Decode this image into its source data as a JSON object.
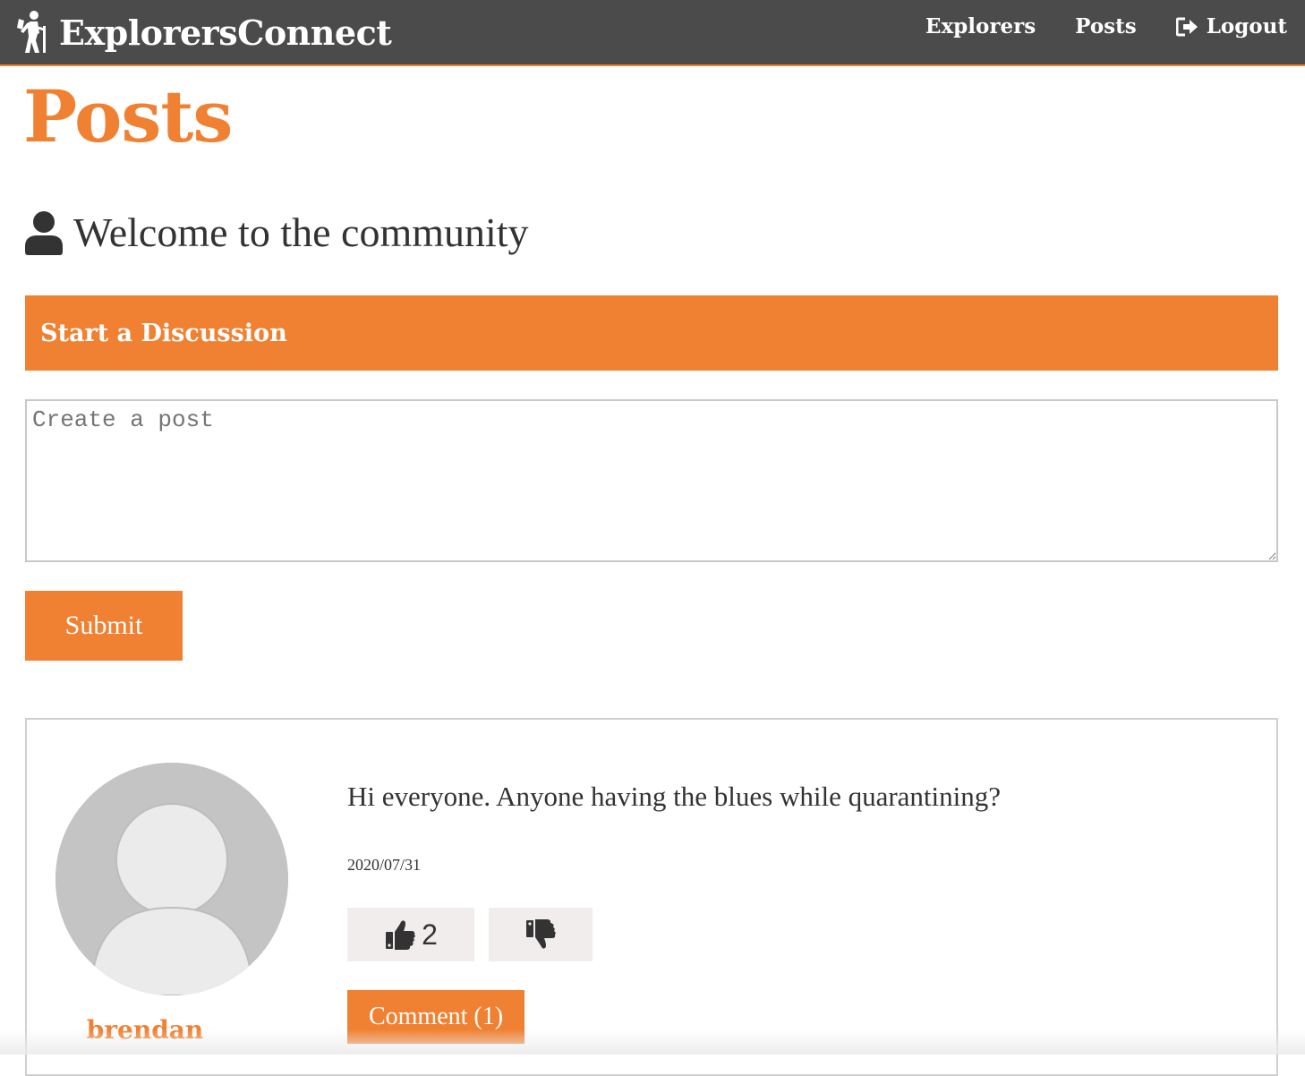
{
  "navbar": {
    "brand": "ExplorersConnect",
    "brand_icon": "hiker-icon",
    "links": [
      {
        "label": "Explorers"
      },
      {
        "label": "Posts"
      },
      {
        "label": "Logout",
        "icon": "logout-icon"
      }
    ]
  },
  "page": {
    "title": "Posts",
    "welcome": "Welcome to the community",
    "welcome_icon": "user-icon"
  },
  "discussion": {
    "header": "Start a Discussion",
    "textarea_placeholder": "Create a post",
    "textarea_value": "",
    "submit_label": "Submit"
  },
  "posts": [
    {
      "author": "brendan",
      "text": "Hi everyone. Anyone having the blues while quarantining?",
      "date": "2020/07/31",
      "likes": "2",
      "comment_label": "Comment (1)"
    }
  ],
  "colors": {
    "accent": "#f08132",
    "navbar_bg": "#4b4b4b",
    "vote_bg": "#f2eded",
    "avatar_bg": "#c4c4c4"
  }
}
